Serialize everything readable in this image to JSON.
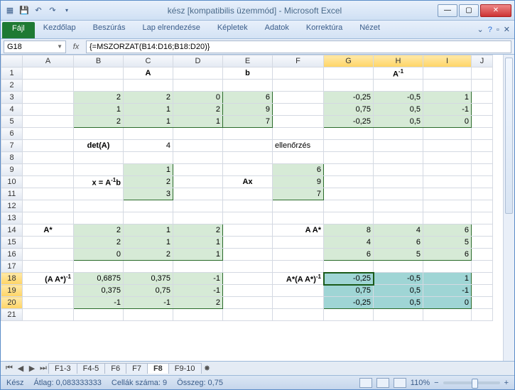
{
  "window": {
    "title": "kész  [kompatibilis üzemmód] - Microsoft Excel"
  },
  "ribbon": {
    "file": "Fájl",
    "tabs": [
      "Kezdőlap",
      "Beszúrás",
      "Lap elrendezése",
      "Képletek",
      "Adatok",
      "Korrektúra",
      "Nézet"
    ]
  },
  "namebox": "G18",
  "formula": "{=MSZORZAT(B14:D16;B18:D20)}",
  "cols": [
    "A",
    "B",
    "C",
    "D",
    "E",
    "F",
    "G",
    "H",
    "I",
    "J"
  ],
  "labels": {
    "A": "A",
    "b": "b",
    "Ainv": "A",
    "det": "det(",
    "detA": "A",
    ")": ")",
    "ellen": "ellenőrzés",
    "x": "x = A",
    "xb": "b",
    "Ax": "Ax",
    "Astar": "A*",
    "AAstar": "A A*",
    "AAinv": "(A A*)",
    "AstarAAinv": "A*(A A*)"
  },
  "det": "4",
  "m": {
    "A": [
      [
        "2",
        "2",
        "0"
      ],
      [
        "1",
        "1",
        "2"
      ],
      [
        "2",
        "1",
        "1"
      ]
    ],
    "b": [
      [
        "6"
      ],
      [
        "9"
      ],
      [
        "7"
      ]
    ],
    "Ainv": [
      [
        "-0,25",
        "-0,5",
        "1"
      ],
      [
        "0,75",
        "0,5",
        "-1"
      ],
      [
        "-0,25",
        "0,5",
        "0"
      ]
    ],
    "x": [
      [
        "1"
      ],
      [
        "2"
      ],
      [
        "3"
      ]
    ],
    "Ax": [
      [
        "6"
      ],
      [
        "9"
      ],
      [
        "7"
      ]
    ],
    "Astar": [
      [
        "2",
        "1",
        "2"
      ],
      [
        "2",
        "1",
        "1"
      ],
      [
        "0",
        "2",
        "1"
      ]
    ],
    "AAstar": [
      [
        "8",
        "4",
        "6"
      ],
      [
        "4",
        "6",
        "5"
      ],
      [
        "6",
        "5",
        "6"
      ]
    ],
    "AAinv": [
      [
        "0,6875",
        "0,375",
        "-1"
      ],
      [
        "0,375",
        "0,75",
        "-1"
      ],
      [
        "-1",
        "-1",
        "2"
      ]
    ],
    "sel": [
      [
        "-0,25",
        "-0,5",
        "1"
      ],
      [
        "0,75",
        "0,5",
        "-1"
      ],
      [
        "-0,25",
        "0,5",
        "0"
      ]
    ]
  },
  "sheets": [
    "F1-3",
    "F4-5",
    "F6",
    "F7",
    "F8",
    "F9-10"
  ],
  "active_sheet": "F8",
  "status": {
    "ready": "Kész",
    "avg": "Átlag: 0,083333333",
    "count": "Cellák száma: 9",
    "sum": "Összeg: 0,75",
    "zoom": "110%"
  },
  "chart_data": null
}
